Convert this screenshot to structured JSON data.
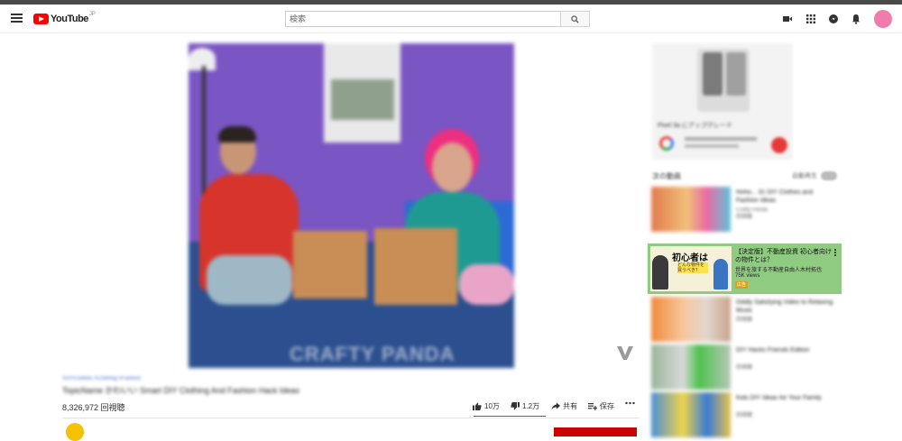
{
  "masthead": {
    "logo_text": "YouTube",
    "logo_sup": "JP",
    "search_placeholder": "検索",
    "icons": [
      "menu-icon",
      "search-icon",
      "video-camera-icon",
      "apps-grid-icon",
      "messages-icon",
      "bell-icon",
      "avatar"
    ]
  },
  "player": {
    "watermark": "CRAFTY PANDA"
  },
  "video": {
    "views": "8,326,972 回視聴",
    "like_count": "10万",
    "dislike_count": "1.2万",
    "share_label": "共有",
    "save_label": "保存"
  },
  "sidebar": {
    "ad_rec": {
      "title": "【決定版】不動産投資 初心者向けの物件とは？",
      "channel": "世界を旅する不動産自由人木村拓也",
      "views": "75K views",
      "badge": "広告",
      "thumb_big": "初心者は",
      "thumb_small": "どんな物件を買うべき？"
    }
  },
  "colors": {
    "brand_red": "#ff0000",
    "ad_highlight": "#8fcb80",
    "avatar": "#f07cac"
  }
}
